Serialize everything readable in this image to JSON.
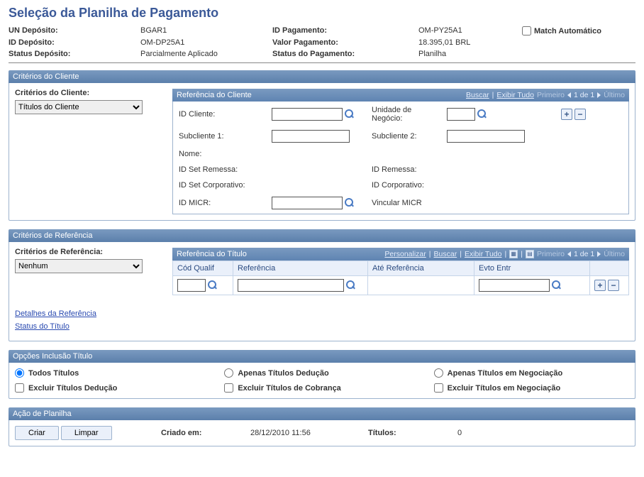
{
  "title": "Seleção da Planilha de Pagamento",
  "header": {
    "un_deposito_lbl": "UN Depósito:",
    "un_deposito_val": "BGAR1",
    "id_deposito_lbl": "ID Depósito:",
    "id_deposito_val": "OM-DP25A1",
    "status_deposito_lbl": "Status Depósito:",
    "status_deposito_val": "Parcialmente Aplicado",
    "id_pagamento_lbl": "ID Pagamento:",
    "id_pagamento_val": "OM-PY25A1",
    "valor_pagamento_lbl": "Valor Pagamento:",
    "valor_pagamento_val": "18.395,01 BRL",
    "status_pagamento_lbl": "Status do Pagamento:",
    "status_pagamento_val": "Planilha",
    "match_auto_lbl": "Match Automático"
  },
  "sections": {
    "criterios_cliente": "Critérios do Cliente",
    "criterios_referencia": "Critérios de Referência",
    "opcoes_inclusao": "Opções Inclusão Título",
    "acao_planilha": "Ação de Planilha"
  },
  "cliente": {
    "criterios_lbl": "Critérios do Cliente:",
    "criterios_sel": "Títulos do Cliente",
    "criterios_options": [
      "Títulos do Cliente"
    ],
    "ref_title": "Referência do Cliente",
    "buscar": "Buscar",
    "exibir_tudo": "Exibir Tudo",
    "primeiro": "Primeiro",
    "pager_txt": "1 de 1",
    "ultimo": "Último",
    "id_cliente_lbl": "ID Cliente:",
    "unidade_negocio_lbl": "Unidade de Negócio:",
    "subcliente1_lbl": "Subcliente 1:",
    "subcliente2_lbl": "Subcliente 2:",
    "nome_lbl": "Nome:",
    "id_set_remessa_lbl": "ID Set Remessa:",
    "id_remessa_lbl": "ID Remessa:",
    "id_set_corp_lbl": "ID Set Corporativo:",
    "id_corp_lbl": "ID Corporativo:",
    "id_micr_lbl": "ID MICR:",
    "vincular_micr_lbl": "Vincular MICR"
  },
  "referencia": {
    "criterios_lbl": "Critérios de Referência:",
    "criterios_sel": "Nenhum",
    "criterios_options": [
      "Nenhum"
    ],
    "ref_title": "Referência do Título",
    "personalizar": "Personalizar",
    "buscar": "Buscar",
    "exibir_tudo": "Exibir Tudo",
    "primeiro": "Primeiro",
    "pager_txt": "1 de 1",
    "ultimo": "Último",
    "cols": {
      "cod_qualif": "Cód Qualif",
      "referencia": "Referência",
      "ate_referencia": "Até Referência",
      "evto_entr": "Evto Entr"
    },
    "detalhes_link": "Detalhes da Referência",
    "status_link": "Status do Título"
  },
  "opcoes": {
    "todos_titulos": "Todos Títulos",
    "apenas_deducao": "Apenas Títulos Dedução",
    "apenas_negociacao": "Apenas Títulos em Negociação",
    "excluir_deducao": "Excluir Títulos Dedução",
    "excluir_cobranca": "Excluir Títulos de Cobrança",
    "excluir_negociacao": "Excluir Títulos em Negociação"
  },
  "acao": {
    "criar_btn": "Criar",
    "limpar_btn": "Limpar",
    "criado_em_lbl": "Criado em:",
    "criado_em_val": "28/12/2010 11:56",
    "titulos_lbl": "Títulos:",
    "titulos_val": "0"
  }
}
